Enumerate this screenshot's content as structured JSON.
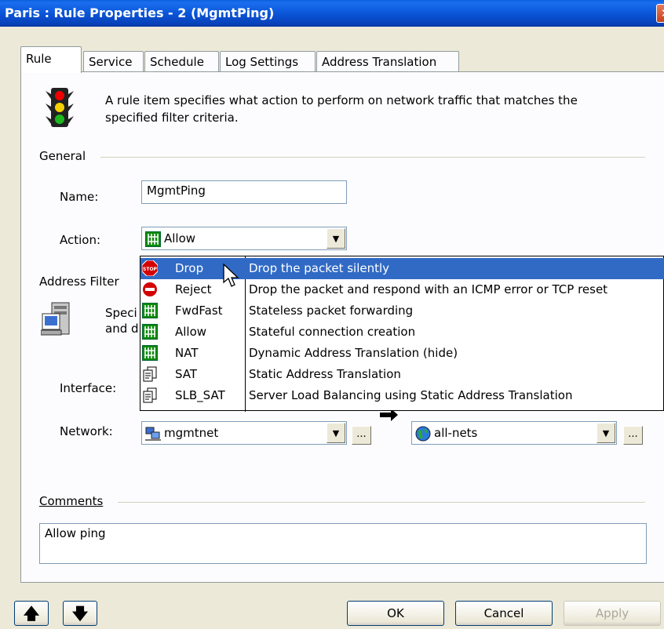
{
  "window": {
    "title": "Paris : Rule Properties - 2 (MgmtPing)",
    "close_glyph": "✕"
  },
  "tabs": [
    "Rule",
    "Service",
    "Schedule",
    "Log Settings",
    "Address Translation"
  ],
  "intro": {
    "icon": "traffic-light-icon",
    "line1": "A rule item specifies what action to perform on network traffic that matches the",
    "line2": "specified filter criteria."
  },
  "general": {
    "heading": "General",
    "name_label": "Name:",
    "name_value": "MgmtPing",
    "action_label": "Action:",
    "action_value": "Allow"
  },
  "address_filter": {
    "heading": "Address Filter",
    "text_line1": "Speci",
    "text_line2": "and d",
    "interface_label": "Interface:",
    "network_label": "Network:",
    "source_network": "mgmtnet",
    "dest_network": "all-nets",
    "browse_label": "..."
  },
  "action_options": [
    {
      "name": "Drop",
      "description": "Drop the packet silently",
      "icon": "stop-icon",
      "selected": true
    },
    {
      "name": "Reject",
      "description": "Drop the packet and respond with an ICMP error or TCP reset",
      "icon": "no-entry-icon"
    },
    {
      "name": "FwdFast",
      "description": "Stateless packet forwarding",
      "icon": "green-gate-icon"
    },
    {
      "name": "Allow",
      "description": "Stateful connection creation",
      "icon": "green-gate-icon"
    },
    {
      "name": "NAT",
      "description": "Dynamic Address Translation (hide)",
      "icon": "green-gate-icon"
    },
    {
      "name": "SAT",
      "description": "Static Address Translation",
      "icon": "document-pages-icon"
    },
    {
      "name": "SLB_SAT",
      "description": "Server Load Balancing using Static Address Translation",
      "icon": "document-pages-icon"
    }
  ],
  "comments": {
    "heading": "Comments",
    "value": "Allow ping"
  },
  "buttons": {
    "up": "🡅",
    "down": "🡇",
    "ok": "OK",
    "cancel": "Cancel",
    "apply": "Apply"
  },
  "colors": {
    "title_bar": "#0b55d8",
    "selection": "#316ac5",
    "dialog_bg": "#ece9d8"
  }
}
